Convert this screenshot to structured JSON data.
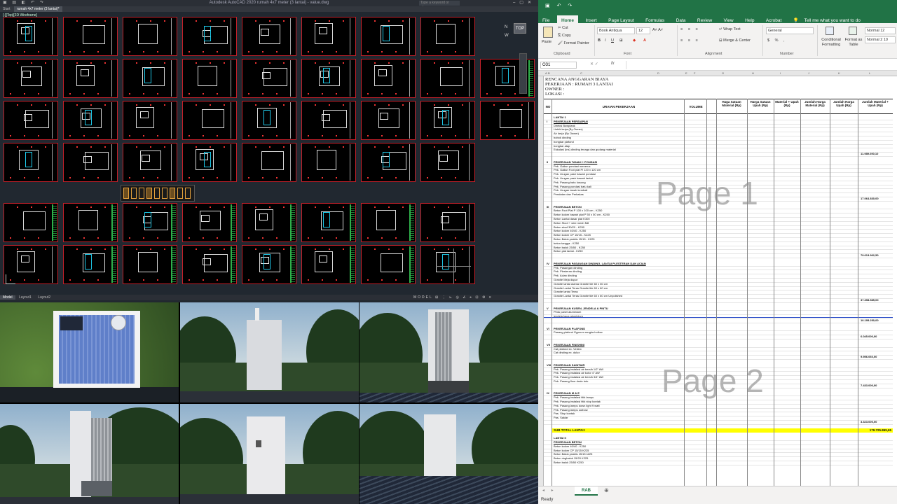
{
  "cad": {
    "title": "Autodesk AutoCAD 2020   rumah 4x7 meter (3 lantai) - value.dwg",
    "search_placeholder": "Type a keyword or phrase",
    "viewport_label": "[-][Top][2D Wireframe]",
    "tabs": [
      "Start",
      "rumah 4x7 meter (3 lantai)*"
    ],
    "layout_tabs": [
      "Model",
      "Layout1",
      "Layout2"
    ],
    "status_text": "MODEL",
    "viewcube_label": "TOP",
    "compass_n": "N",
    "compass_w": "W"
  },
  "renders": {
    "count": 6,
    "views": [
      "top-view",
      "side-view-plain",
      "front-view-facade",
      "perspective-view",
      "side-view-with-window",
      "rear-view-waterfront"
    ]
  },
  "excel": {
    "quick_access_icons": [
      "save-icon",
      "undo-icon",
      "redo-icon"
    ],
    "menu": [
      "File",
      "Home",
      "Insert",
      "Page Layout",
      "Formulas",
      "Data",
      "Review",
      "View",
      "Help",
      "Acrobat",
      "Tell me what you want to do"
    ],
    "active_menu": "Home",
    "ribbon": {
      "paste": "Paste",
      "cut": "Cut",
      "copy": "Copy",
      "format_painter": "Format Painter",
      "clipboard": "Clipboard",
      "font_name": "Book Antiqua",
      "font_size": "12",
      "font_group": "Font",
      "wrap_text": "Wrap Text",
      "merge_center": "Merge & Center",
      "alignment_group": "Alignment",
      "number_format": "General",
      "number_group": "Number",
      "conditional_formatting": "Conditional Formatting",
      "format_as_table": "Format as Table",
      "style1": "Normal 12",
      "style2": "Normal 2 10"
    },
    "name_box": "O31",
    "fx": "fx",
    "columns": [
      "A",
      "B",
      "C",
      "D",
      "E",
      "F",
      "G",
      "H",
      "I",
      "J",
      "K",
      "L"
    ],
    "header": {
      "line1": "RENCANA ANGGARAN BIAYA",
      "line2": "PEKERJAAN   : RUMAH 3 LANTAI",
      "line3": "OWNER        :",
      "line4": "LOKASI        :"
    },
    "column_headers": {
      "no": "NO",
      "uraian": "URAIAN PEKERJAAN",
      "volume": "VOLUME",
      "harga_material": "Haga Satuan Material (Rp)",
      "harga_upah": "Harga Satuan Upah (Rp)",
      "material_upah": "Material + Upah (Rp)",
      "jumlah_material": "Jumlah Harga Material (Rp)",
      "jumlah_upah": "Jumlah Harga Upah (Rp)",
      "jumlah_total": "Jumlah Material + Upah (Rp)"
    },
    "watermark1": "Page 1",
    "watermark2": "Page 2",
    "lantai1": "LANTAI 1",
    "lantai2": "LANTAI II",
    "sections": [
      {
        "roman": "I",
        "title": "PEKERJAAN PERSIAPAN",
        "total": "11.989.050,10",
        "items": [
          "Direksi Bowplank",
          "Listrik kerja (By Owner)",
          "Air kerja (By Owner)",
          "bobok dinding",
          "bongkar plafond",
          "bongkar atap",
          "Eskalasi (ins) dinding tenaga dan gudang material"
        ]
      },
      {
        "roman": "II",
        "title": "PEKERJAAN TANAH + PONDASI",
        "total": "17.064.830,00",
        "items": [
          "Pek. Galian pondasi menerus",
          "Pek. Galian Foot plat Pl 120 x 120 cm",
          "Pek. Urugan pasir bawah pondasi",
          "Pek. Urugan pasir bawah lantai",
          "Pek. Pasang batu kosong",
          "Pek. Pasang pondasi batu kali",
          "Pek. Urugan tanah kembali",
          "Peralatan dan Perkakas"
        ]
      },
      {
        "roman": "III",
        "title": "PEKERJAAN BETON",
        "total": "79.613.962,50",
        "items": [
          "Beton Foot Plat P 100 x 100 cm - K250",
          "Beton kolom bawah plat P 50 x 50 cm - K250",
          "Beton Lantai dasar plat K300",
          "Beton Sloof + wire mesh M8",
          "Beton sloof 30/20 - K250",
          "Beton kolom 40/40 - K250",
          "Beton kolom CP 15/15 - K225",
          "Beton Balok praktis 15/15 - K225",
          "beton tangga - K250",
          "Beton balok 25/50 - K250",
          "Beton plat lantai - K250"
        ]
      },
      {
        "roman": "IV",
        "title": "PEKERJAAN PASANGAN DINDING, LANTAI PLESTERAN DAN ACIAN",
        "total": "37.398.585,00",
        "items": [
          "Pek. Pasangan dinding",
          "Pek. Plesteran dinding",
          "Pek. Acian dinding",
          "Granite Meja dapur",
          "Granite lantai utama Granite tile 60 x 60 cm",
          "Granite Lantai Teras Granite tile 60 x 60 cm",
          "Granite lantai Teras",
          "Granite Lantai Teras Granite tile 60 x 60 cm Unpolished"
        ]
      },
      {
        "roman": "V",
        "title": "PEKERJAAN KUSEN, JENDELA & PINTU",
        "total": "10.195.250,00",
        "items": [
          "Pintu panel aluminium",
          "jendela kaca aluminium"
        ]
      },
      {
        "roman": "VI",
        "title": "PEKERJAAN PLAFOND",
        "total": "6.045.000,00",
        "items": [
          "Pasang plafond Gypsum rangka hollow"
        ]
      },
      {
        "roman": "VII",
        "title": "PEKERJAAN FINISHINI",
        "total": "9.956.060,00",
        "items": [
          "Cat plafond ex. Vinilex",
          "Cat dinding ex. dulux"
        ]
      },
      {
        "roman": "VIII",
        "title": "PEKERJAAN SANITAIR",
        "total": "7.433.000,00",
        "items": [
          "Pek. Pasang instalasi air bersih 1/2\" AW",
          "Pek. Pasang instalasi air kotor 4\" AW",
          "Pek. Pasang instalasi air bersih 3/4\" AW",
          "Pek. Pasang floor drain toto"
        ]
      },
      {
        "roman": "IX",
        "title": "PEKERJAAN M & E",
        "total": "3.323.000,00",
        "items": [
          "Pek. Pasang instalasi titik lampu",
          "Pek. Pasang instalasi titik stop kontak",
          "Pek. Pasang lampu down light 9 watt",
          "Pek. Pasang lampu outbow",
          "Pas. Stop kontak",
          "Pas. Saklar"
        ]
      }
    ],
    "subtotal_label": "SUB TOTAL LANTAI I",
    "subtotal_value": "179.725.865,65",
    "lantai2_section": "PEKERJAAN BETON",
    "lantai2_items": [
      "Beton kolom 40/40 - K250",
      "Beton kolom CP 15/15 K225",
      "Beton Balok praktis 15/15 k225",
      "Beton ringbalok 15/20 K225",
      "Beton balok 25/50 K250"
    ],
    "sheet_tab": "RAB",
    "status": "Ready"
  }
}
